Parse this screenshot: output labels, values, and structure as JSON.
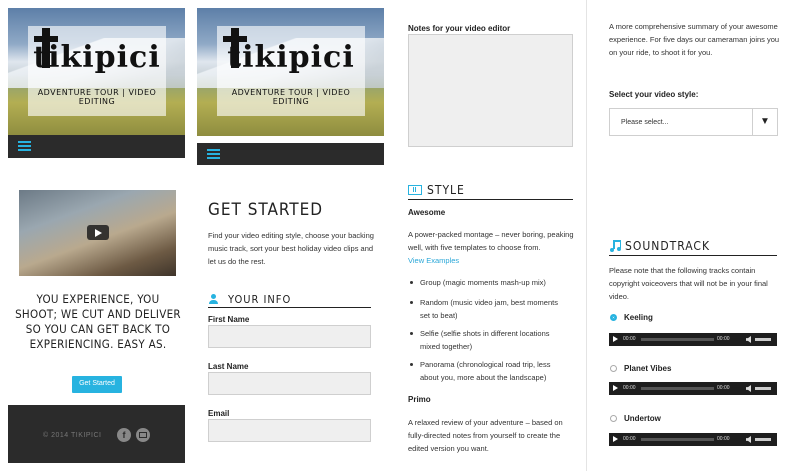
{
  "hero": {
    "logo_title": "tikipici",
    "logo_subtitle": "ADVENTURE TOUR | VIDEO EDITING"
  },
  "landing": {
    "headline": "YOU EXPERIENCE, YOU SHOOT; WE CUT AND DELIVER SO YOU CAN GET BACK TO EXPERIENCING. EASY AS.",
    "cta_label": "Get Started",
    "footer_copyright": "© 2014 TIKIPICI"
  },
  "started": {
    "title": "GET STARTED",
    "intro": "Find your video editing style, choose your backing music track, sort your best holiday video clips and let us do the rest.",
    "info_heading": "YOUR INFO",
    "fields": [
      {
        "label": "First Name",
        "value": ""
      },
      {
        "label": "Last Name",
        "value": ""
      },
      {
        "label": "Email",
        "value": ""
      }
    ]
  },
  "notes": {
    "label": "Notes for your video editor",
    "value": ""
  },
  "style": {
    "heading": "STYLE",
    "awesome_title": "Awesome",
    "awesome_desc": "A power-packed montage – never boring, peaking well, with five templates to choose from.",
    "view_examples": "View Examples",
    "awesome_items": [
      "Group (magic moments mash-up mix)",
      "Random (music video jam, best moments set to beat)",
      "Selfie (selfie shots in different locations mixed together)",
      "Panorama (chronological road trip, less about you, more about the landscape)"
    ],
    "primo_title": "Primo",
    "primo_desc": "A relaxed review of your adventure – based on fully-directed notes from yourself to create the edited version you want."
  },
  "summary": {
    "text": "A more comprehensive summary of your awesome experience. For five days our cameraman joins you on your ride, to shoot it for you.",
    "select_label": "Select your video style:",
    "select_value": "Please select...",
    "select_arrow": "▼"
  },
  "soundtrack": {
    "heading": "SOUNDTRACK",
    "note": "Please note that the following tracks contain copyright voiceovers that will not be in your final video.",
    "tracks": [
      {
        "name": "Keeling",
        "selected": true,
        "time_start": "00:00",
        "time_end": "00:00"
      },
      {
        "name": "Planet Vibes",
        "selected": false,
        "time_start": "00:00",
        "time_end": "00:00"
      },
      {
        "name": "Undertow",
        "selected": false,
        "time_start": "00:00",
        "time_end": "00:00"
      }
    ]
  },
  "colors": {
    "accent": "#27b3e0",
    "dark": "#2b2b2b"
  }
}
